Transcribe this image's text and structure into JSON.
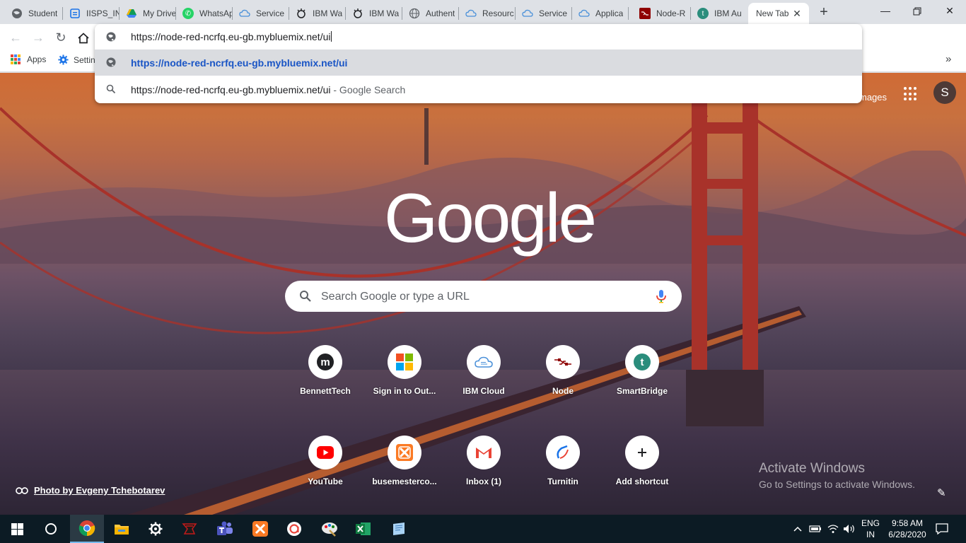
{
  "tabs": [
    {
      "label": "Student",
      "icon": "globe-icon"
    },
    {
      "label": "IISPS_IN",
      "icon": "form-icon"
    },
    {
      "label": "My Drive",
      "icon": "drive-icon"
    },
    {
      "label": "WhatsApp",
      "icon": "whatsapp-icon"
    },
    {
      "label": "Service",
      "icon": "cloud-icon"
    },
    {
      "label": "IBM Wa",
      "icon": "ibm-watson-icon"
    },
    {
      "label": "IBM Wa",
      "icon": "ibm-watson-icon"
    },
    {
      "label": "Authent",
      "icon": "globe-icon"
    },
    {
      "label": "Resourc",
      "icon": "cloud-icon"
    },
    {
      "label": "Service",
      "icon": "cloud-icon"
    },
    {
      "label": "Applica",
      "icon": "cloud-icon"
    },
    {
      "label": "Node-R",
      "icon": "node-red-icon"
    },
    {
      "label": "IBM Au",
      "icon": "t-icon"
    },
    {
      "label": "New Tab",
      "icon": "none"
    }
  ],
  "omnibox": {
    "value": "https://node-red-ncrfq.eu-gb.mybluemix.net/ui",
    "suggestions": [
      {
        "text": "https://node-red-ncrfq.eu-gb.mybluemix.net/ui",
        "desc": ""
      },
      {
        "text": "https://node-red-ncrfq.eu-gb.mybluemix.net/ui",
        "desc": " - Google Search"
      }
    ]
  },
  "bookmarks": {
    "apps": "Apps",
    "settings": "Settin"
  },
  "newtab": {
    "images_link": "mages",
    "account_initial": "S",
    "logo": "Google",
    "search_placeholder": "Search Google or type a URL",
    "shortcuts_row1": [
      {
        "label": "BennettTech",
        "icon": "m-icon"
      },
      {
        "label": "Sign in to Out...",
        "icon": "microsoft-icon"
      },
      {
        "label": "IBM Cloud",
        "icon": "cloud-icon"
      },
      {
        "label": "Node",
        "icon": "node-red-icon"
      },
      {
        "label": "SmartBridge",
        "icon": "t-icon"
      }
    ],
    "shortcuts_row2": [
      {
        "label": "YouTube",
        "icon": "youtube-icon"
      },
      {
        "label": "busemesterco...",
        "icon": "xampp-icon"
      },
      {
        "label": "Inbox (1)",
        "icon": "gmail-icon"
      },
      {
        "label": "Turnitin",
        "icon": "turnitin-icon"
      },
      {
        "label": "Add shortcut",
        "icon": "plus-icon"
      }
    ],
    "credit": "Photo by Evgeny Tchebotarev"
  },
  "activation": {
    "title": "Activate Windows",
    "subtitle": "Go to Settings to activate Windows."
  },
  "taskbar": {
    "lang_line1": "ENG",
    "lang_line2": "IN",
    "time": "9:58 AM",
    "date": "6/28/2020"
  },
  "colors": {
    "omnibox_selected_link": "#1a55c5",
    "tab_strip": "#dee1e6",
    "taskbar": "#0c1b24"
  }
}
